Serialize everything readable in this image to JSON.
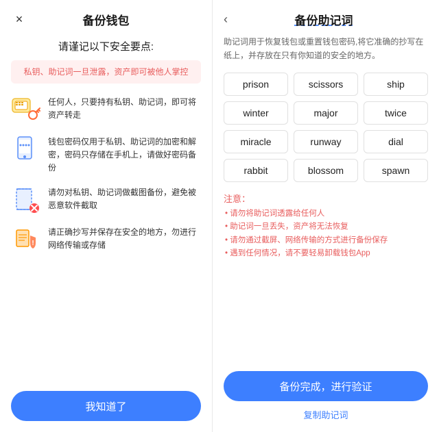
{
  "left": {
    "close_icon": "×",
    "title": "备份钱包",
    "safety_heading": "请谨记以下安全要点:",
    "warning": "私钥、助记词一旦泄露，资产即可被他人掌控",
    "items": [
      {
        "id": "key",
        "text": "任何人，只要持有私钥、助记词，即可将资产转走"
      },
      {
        "id": "phone",
        "text": "钱包密码仅用于私钥、助记词的加密和解密，密码只存储在手机上，请做好密码备份"
      },
      {
        "id": "screenshot",
        "text": "请勿对私钥、助记词做截图备份，避免被恶意软件截取"
      },
      {
        "id": "copy",
        "text": "请正确抄写并保存在安全的地方，勿进行网络传输或存储"
      }
    ],
    "confirm_btn": "我知道了"
  },
  "right": {
    "back_icon": "‹",
    "title": "备份助记词",
    "desc": "助记词用于恢复钱包或重置钱包密码,将它准确的抄写在纸上，并存放在只有你知道的安全的地方。",
    "mnemonic_words": [
      "prison",
      "scissors",
      "ship",
      "winter",
      "major",
      "twice",
      "miracle",
      "runway",
      "dial",
      "rabbit",
      "blossom",
      "spawn"
    ],
    "notice_title": "注意：",
    "notice_items": [
      "• 请勿将助记词透露给任何人",
      "• 助记词一旦丢失，资产将无法恢复",
      "• 请勿通过截屏、网络传输的方式进行备份保存",
      "• 遇到任何情况，请不要轻易卸载钱包App"
    ],
    "backup_btn": "备份完成，进行验证",
    "copy_link": "复制助记词"
  }
}
